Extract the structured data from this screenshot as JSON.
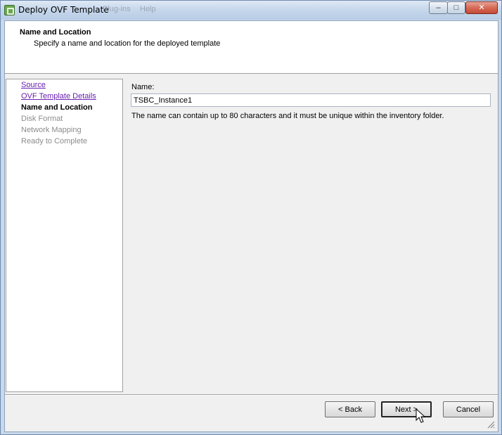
{
  "window": {
    "title": "Deploy OVF Template",
    "ghost_menu": [
      "Plug-ins",
      "Help"
    ],
    "controls": {
      "minimize": "‒",
      "maximize": "□",
      "close": "✕"
    }
  },
  "header": {
    "title": "Name and Location",
    "subtitle": "Specify a name and location for the deployed template"
  },
  "nav": {
    "items": [
      {
        "label": "Source",
        "state": "link"
      },
      {
        "label": "OVF Template Details",
        "state": "link"
      },
      {
        "label": "Name and Location",
        "state": "current"
      },
      {
        "label": "Disk Format",
        "state": "disabled"
      },
      {
        "label": "Network Mapping",
        "state": "disabled"
      },
      {
        "label": "Ready to Complete",
        "state": "disabled"
      }
    ]
  },
  "form": {
    "name_label": "Name:",
    "name_value": "TSBC_Instance1",
    "hint": "The name can contain up to 80 characters and it must be unique within the inventory folder."
  },
  "buttons": {
    "back": "< Back",
    "next": "Next >",
    "cancel": "Cancel"
  },
  "colors": {
    "link": "#6a1fb0",
    "disabled": "#8c8c8c",
    "panel_bg": "#f0f0f0"
  },
  "icons": {
    "app": "vsphere-deploy-icon",
    "cursor": "mouse-pointer-icon",
    "grip": "resize-grip-icon"
  }
}
